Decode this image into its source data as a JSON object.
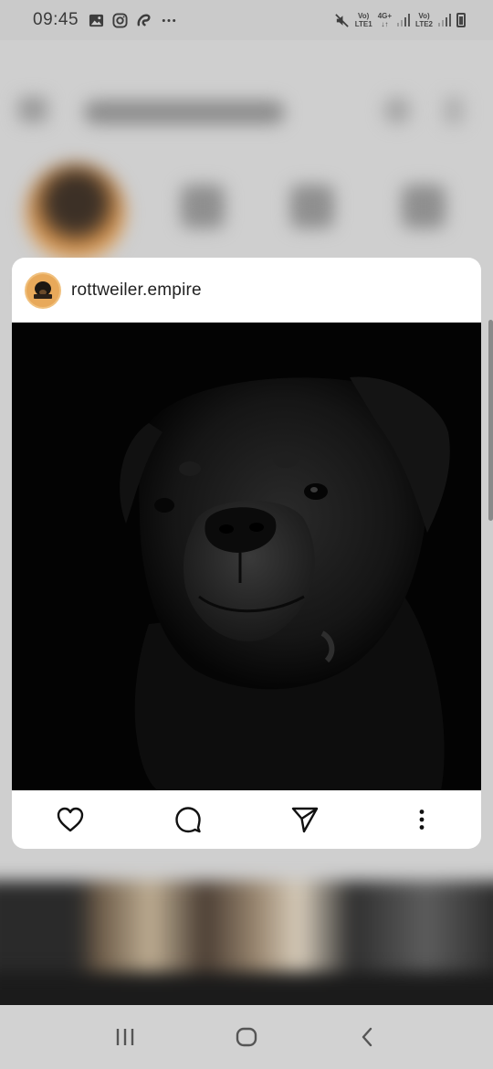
{
  "status_bar": {
    "time": "09:45",
    "left_icons": [
      "gallery-icon",
      "instagram-icon",
      "airtel-icon",
      "more-dots-icon"
    ],
    "sim1_label_top": "Vo)",
    "sim1_label_bottom": "LTE1",
    "network_type": "4G+",
    "sim2_label_top": "Vo)",
    "sim2_label_bottom": "LTE2",
    "right_icons": [
      "mute-icon",
      "signal-icon",
      "battery-icon"
    ]
  },
  "preview": {
    "username": "rottweiler.empire",
    "image_description_icon": "rottweiler-photo",
    "actions": [
      "heart-icon",
      "comment-icon",
      "share-icon",
      "more-vertical-icon"
    ]
  },
  "nav_bar": {
    "buttons": [
      "recent-apps-icon",
      "home-icon",
      "back-icon"
    ]
  },
  "colors": {
    "card_background": "#ffffff",
    "scrim": "#cfcfcf",
    "avatar_orange": "#e8a95a",
    "photo_background": "#030303"
  }
}
